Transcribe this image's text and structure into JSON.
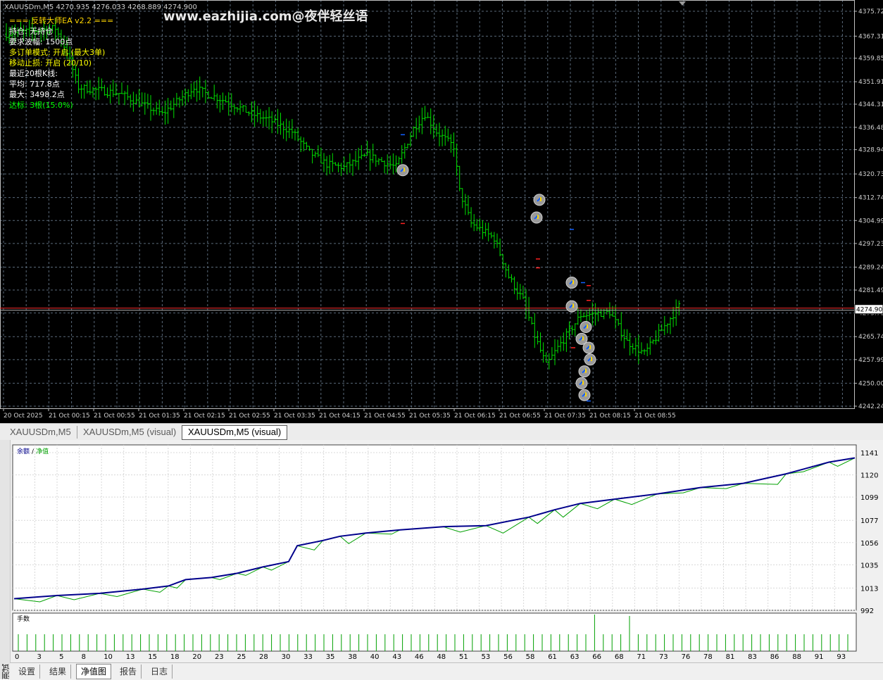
{
  "chart_header": {
    "symbol_line": "XAUUSDm,M5  4270.935 4276.033 4268.889 4274.900",
    "watermark": "www.eazhijia.com@夜伴轻丝语",
    "current_price": "4274.900"
  },
  "ea_panel": {
    "title": "=== 反转大师EA v2.2 ===",
    "position": "持仓: 无持仓",
    "required_swing": "要求波幅: 1500点",
    "multi_mode": "多订单模式: 开启 (最大3单)",
    "trailing": "移动止损: 开启 (20/10)",
    "recent": "最近20根K线:",
    "avg": "平均: 717.8点",
    "max": "最大: 3498.2点",
    "hit": "达标: 3根(15.0%)"
  },
  "price_axis": [
    "4375.720",
    "4367.310",
    "4359.850",
    "4351.910",
    "4344.315",
    "4336.485",
    "4328.940",
    "4320.735",
    "4312.745",
    "4304.990",
    "4297.235",
    "4289.245",
    "4281.490",
    "4273.735",
    "4265.745",
    "4257.990",
    "4250.000",
    "4242.245"
  ],
  "time_axis": [
    "20 Oct 2025",
    "21 Oct 00:15",
    "21 Oct 00:55",
    "21 Oct 01:35",
    "21 Oct 02:15",
    "21 Oct 02:55",
    "21 Oct 03:35",
    "21 Oct 04:15",
    "21 Oct 04:55",
    "21 Oct 05:35",
    "21 Oct 06:15",
    "21 Oct 06:55",
    "21 Oct 07:35",
    "21 Oct 08:15",
    "21 Oct 08:55"
  ],
  "chart_tabs": [
    "XAUUSDm,M5",
    "XAUUSDm,M5 (visual)",
    "XAUUSDm,M5 (visual)"
  ],
  "active_chart_tab": 2,
  "equity": {
    "legend_balance": "余额",
    "legend_sep": "/",
    "legend_equity": "净值",
    "lots_label": "手数",
    "y_ticks": [
      "1141",
      "1120",
      "1099",
      "1077",
      "1056",
      "1035",
      "1013",
      "992"
    ],
    "x_ticks": [
      "0",
      "3",
      "5",
      "8",
      "10",
      "13",
      "15",
      "18",
      "20",
      "23",
      "25",
      "28",
      "30",
      "33",
      "35",
      "38",
      "40",
      "43",
      "46",
      "48",
      "51",
      "53",
      "56",
      "58",
      "61",
      "63",
      "66",
      "68",
      "71",
      "73",
      "76",
      "78",
      "81",
      "83",
      "86",
      "88",
      "91",
      "93"
    ]
  },
  "side_label": "测试",
  "bottom_tabs": [
    "设置",
    "结果",
    "净值图",
    "报告",
    "日志"
  ],
  "active_bottom_tab": 2,
  "colors": {
    "bull": "#00e000",
    "balance": "#00008b",
    "equity": "#00a000",
    "panel_title": "#ffd700",
    "grid": "#5a6a7a"
  }
}
